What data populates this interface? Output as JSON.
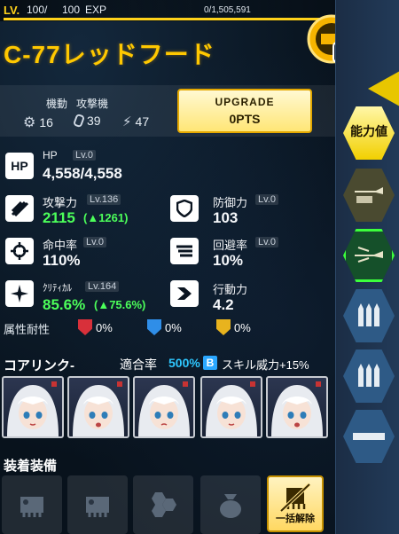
{
  "header": {
    "lv_label": "LV.",
    "level": "100",
    "sep": "/",
    "max_level": "100",
    "exp_label": "EXP",
    "exp_points": "0/1,505,591",
    "exp_fill": 1.0
  },
  "unit": {
    "name": "C-77レッドフード"
  },
  "summary": {
    "mobility_label": "機動",
    "attacker_label": "攻撃機",
    "gear_value": "16",
    "weight_value": "39",
    "bolt_value": "47",
    "upgrade_label": "UPGRADE",
    "upgrade_pts": "0PTS"
  },
  "stats": {
    "hp": {
      "name": "HP",
      "lv": "Lv.0",
      "value": "4,558/4,558"
    },
    "attack": {
      "name": "攻撃力",
      "lv": "Lv.136",
      "value": "2115",
      "bonus": "(▲1261)"
    },
    "defense": {
      "name": "防御力",
      "lv": "Lv.0",
      "value": "103"
    },
    "accuracy": {
      "name": "命中率",
      "lv": "Lv.0",
      "value": "110%"
    },
    "evasion": {
      "name": "回避率",
      "lv": "Lv.0",
      "value": "10%"
    },
    "critical": {
      "name": "ｸﾘﾃｨｶﾙ",
      "lv": "Lv.164",
      "value": "85.6%",
      "bonus": "(▲75.6%)"
    },
    "action": {
      "name": "行動力",
      "value": "4.2"
    }
  },
  "resist": {
    "label": "属性耐性",
    "fire": "0%",
    "ice": "0%",
    "electric": "0%"
  },
  "core_link": {
    "label": "コアリンク-",
    "rate_label": "適合率",
    "rate": "500%",
    "badge": "B",
    "skill_bonus": "スキル威力+15%"
  },
  "equipment": {
    "label": "装着装備",
    "unequip_label": "一括解除"
  },
  "tabs": {
    "ability": "能力値"
  },
  "colors": {
    "accent_yellow": "#ffc800",
    "green": "#4cff5a",
    "blue": "#2ec7ff"
  }
}
